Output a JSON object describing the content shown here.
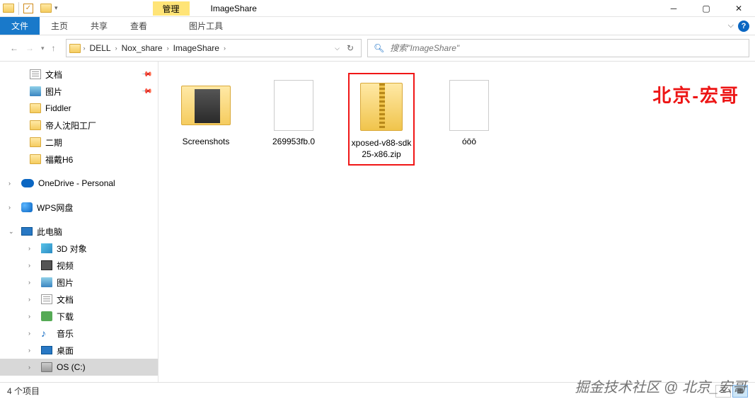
{
  "title": {
    "manage": "管理",
    "app_title": "ImageShare"
  },
  "ribbon": {
    "file": "文件",
    "home": "主页",
    "share": "共享",
    "view": "查看",
    "pic_tools": "图片工具"
  },
  "breadcrumb": [
    "DELL",
    "Nox_share",
    "ImageShare"
  ],
  "search": {
    "placeholder": "搜索\"ImageShare\""
  },
  "sidebar": {
    "pinned": [
      "文档",
      "图片",
      "Fiddler",
      "帝人沈阳工厂",
      "二期",
      "福戴H6"
    ],
    "onedrive": "OneDrive - Personal",
    "wps": "WPS网盘",
    "thispc": "此电脑",
    "pc_items": [
      "3D 对象",
      "视频",
      "图片",
      "文档",
      "下载",
      "音乐",
      "桌面",
      "OS (C:)"
    ]
  },
  "files": [
    {
      "name": "Screenshots",
      "type": "folder"
    },
    {
      "name": "269953fb.0",
      "type": "file"
    },
    {
      "name": "xposed-v88-sdk25-x86.zip",
      "type": "zip",
      "highlighted": true
    },
    {
      "name": "óōō",
      "type": "file"
    }
  ],
  "status": {
    "count": "4 个项目"
  },
  "watermark": {
    "red": "北京-宏哥",
    "bottom": "掘金技术社区 @ 北京_宏哥"
  }
}
